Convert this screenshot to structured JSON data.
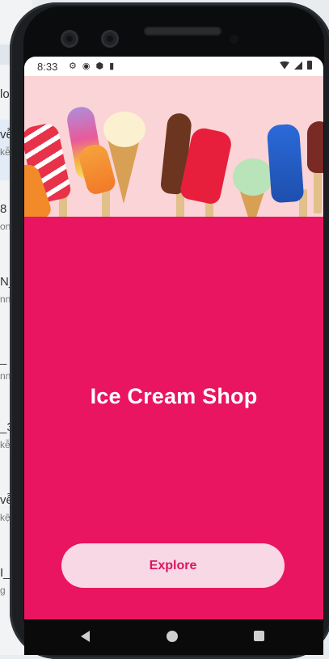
{
  "status_bar": {
    "time": "8:33"
  },
  "app": {
    "title": "Ice Cream Shop",
    "explore_label": "Explore"
  },
  "background_panel": {
    "rows": [
      {
        "main": "lo",
        "sub": ""
      },
      {
        "main": "vễ",
        "sub": "kễ"
      },
      {
        "main": "8",
        "sub": "on"
      },
      {
        "main": "N_",
        "sub": "nn"
      },
      {
        "main": "_",
        "sub": "nn"
      },
      {
        "main": "_3",
        "sub": "kễ"
      },
      {
        "main": "vễ",
        "sub": "kệ"
      },
      {
        "main": "I_",
        "sub": "g"
      }
    ]
  },
  "colors": {
    "screen_background": "#e91560",
    "button_background": "#f8d8e5",
    "button_text": "#d8175e",
    "hero_background": "#fad4d6"
  },
  "icons": [
    "settings-icon",
    "android-icon",
    "shield-icon",
    "sd-card-icon",
    "wifi-icon",
    "signal-icon",
    "battery-icon",
    "back-icon",
    "home-icon",
    "recents-icon"
  ]
}
